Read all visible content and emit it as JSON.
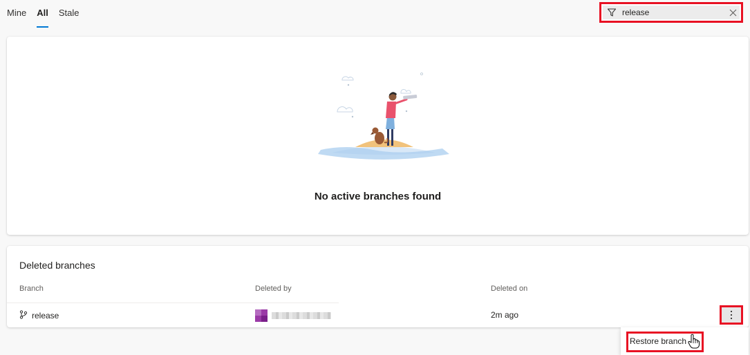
{
  "tabs": [
    {
      "label": "Mine"
    },
    {
      "label": "All"
    },
    {
      "label": "Stale"
    }
  ],
  "active_tab": "All",
  "filter": {
    "value": "release"
  },
  "empty_state": {
    "message": "No active branches found"
  },
  "deleted_branches": {
    "title": "Deleted branches",
    "columns": {
      "branch": "Branch",
      "deleted_by": "Deleted by",
      "deleted_on": "Deleted on"
    },
    "rows": [
      {
        "branch": "release",
        "deleted_on": "2m ago"
      }
    ]
  },
  "context_menu": {
    "restore_label": "Restore branch"
  },
  "icons": {
    "filter": "filter-icon",
    "clear": "close-icon",
    "branch": "branch-icon",
    "more": "more-vertical-icon",
    "cursor": "hand-cursor-icon"
  },
  "colors": {
    "accent": "#0078d4",
    "highlight_border": "#e81123",
    "avatar": "#9b3aa7"
  }
}
